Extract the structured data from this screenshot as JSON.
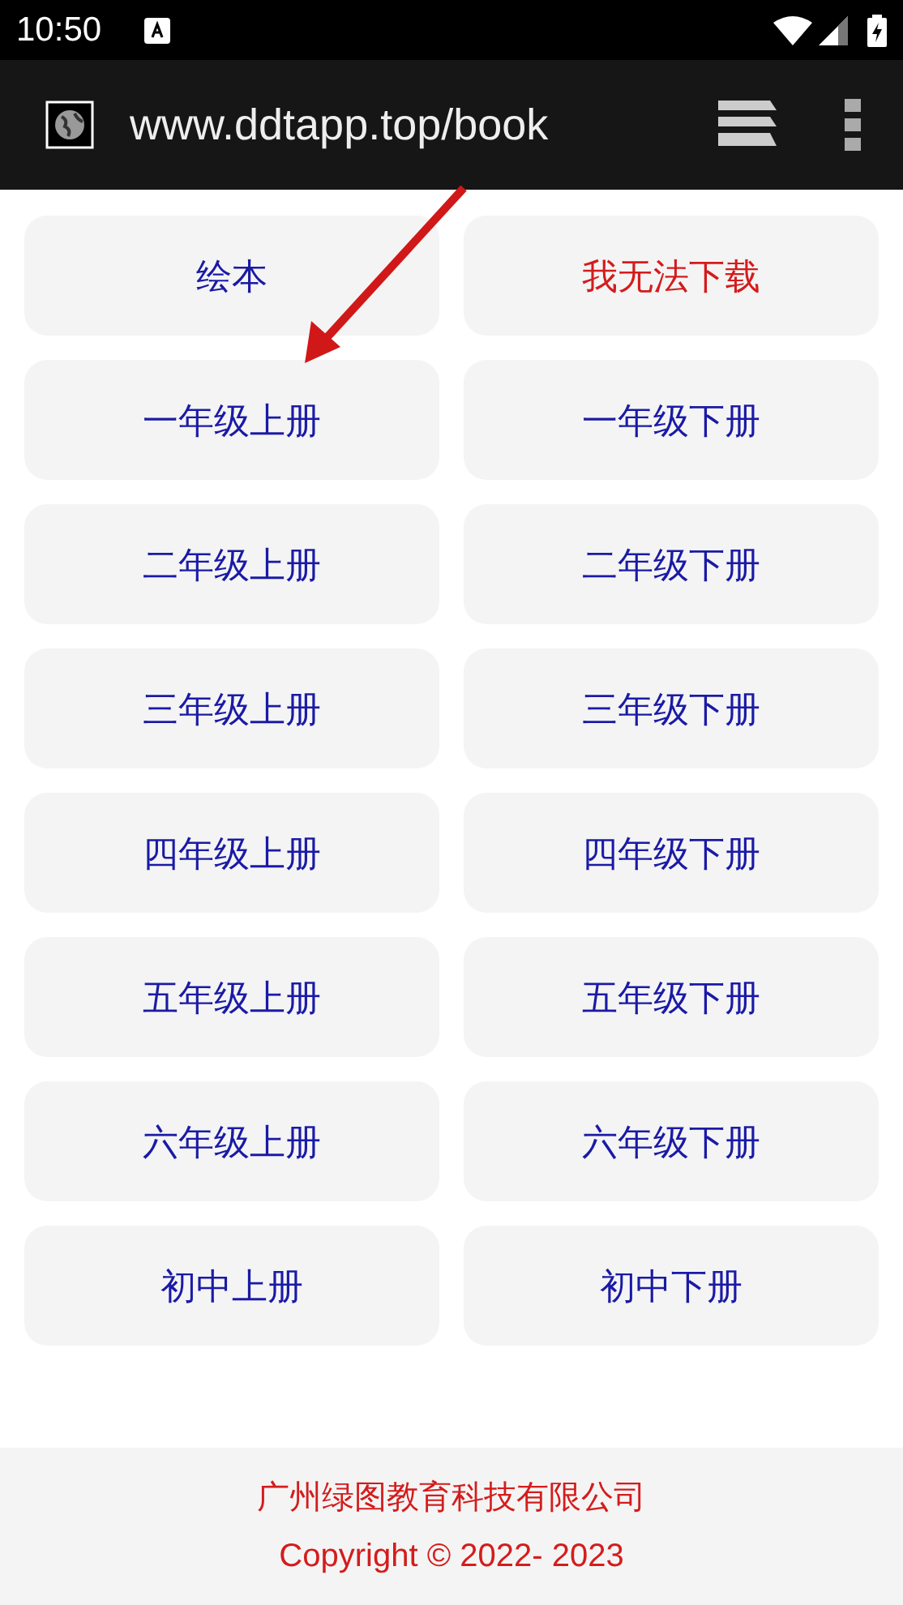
{
  "status_bar": {
    "time": "10:50"
  },
  "browser": {
    "url": "www.ddtapp.top/book"
  },
  "buttons": [
    {
      "label": "绘本",
      "kind": "link"
    },
    {
      "label": "我无法下载",
      "kind": "alert"
    },
    {
      "label": "一年级上册",
      "kind": "link"
    },
    {
      "label": "一年级下册",
      "kind": "link"
    },
    {
      "label": "二年级上册",
      "kind": "link"
    },
    {
      "label": "二年级下册",
      "kind": "link"
    },
    {
      "label": "三年级上册",
      "kind": "link"
    },
    {
      "label": "三年级下册",
      "kind": "link"
    },
    {
      "label": "四年级上册",
      "kind": "link"
    },
    {
      "label": "四年级下册",
      "kind": "link"
    },
    {
      "label": "五年级上册",
      "kind": "link"
    },
    {
      "label": "五年级下册",
      "kind": "link"
    },
    {
      "label": "六年级上册",
      "kind": "link"
    },
    {
      "label": "六年级下册",
      "kind": "link"
    },
    {
      "label": "初中上册",
      "kind": "link"
    },
    {
      "label": "初中下册",
      "kind": "link"
    }
  ],
  "footer": {
    "company": "广州绿图教育科技有限公司",
    "copyright": "Copyright © 2022- 2023"
  }
}
